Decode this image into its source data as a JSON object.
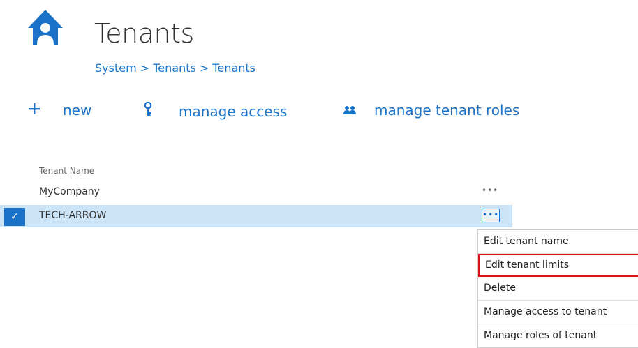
{
  "header": {
    "title": "Tenants",
    "breadcrumb": "System > Tenants > Tenants",
    "icon": "home-icon"
  },
  "toolbar": {
    "new_label": "new",
    "manage_access_label": "manage access",
    "manage_roles_label": "manage tenant roles"
  },
  "table": {
    "column_header": "Tenant Name",
    "rows": [
      {
        "name": "MyCompany",
        "selected": false
      },
      {
        "name": "TECH-ARROW",
        "selected": true
      }
    ]
  },
  "context_menu": {
    "items": [
      "Edit tenant name",
      "Edit tenant limits",
      "Delete",
      "Manage access to tenant",
      "Manage roles of tenant"
    ],
    "highlighted": "Edit tenant limits"
  },
  "colors": {
    "accent": "#1a73c8",
    "selection": "#cce4f7",
    "highlight_border": "#e0101a"
  }
}
